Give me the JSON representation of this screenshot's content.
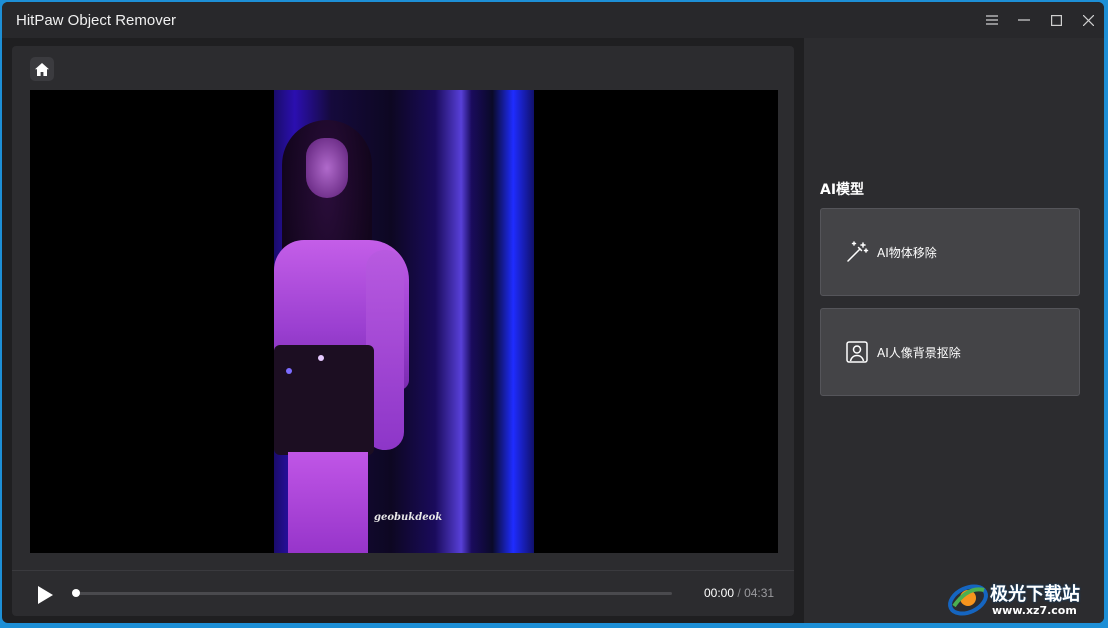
{
  "window": {
    "title": "HitPaw Object Remover"
  },
  "video": {
    "watermark_text": "geobukdeok",
    "current_time": "00:00",
    "separator": "/",
    "total_time": "04:31",
    "progress": 0.0
  },
  "ai_panel": {
    "section_title": "AI模型",
    "cards": [
      {
        "label": "AI物体移除",
        "icon": "magic-wand-icon"
      },
      {
        "label": "AI人像背景抠除",
        "icon": "portrait-icon"
      }
    ]
  },
  "site_logo": {
    "name": "极光下载站",
    "url": "www.xz7.com"
  },
  "colors": {
    "window_bg": "#1f1f21",
    "panel_bg": "#2c2c2f",
    "card_bg": "#444447",
    "accent_border": "#1d8fd6"
  }
}
